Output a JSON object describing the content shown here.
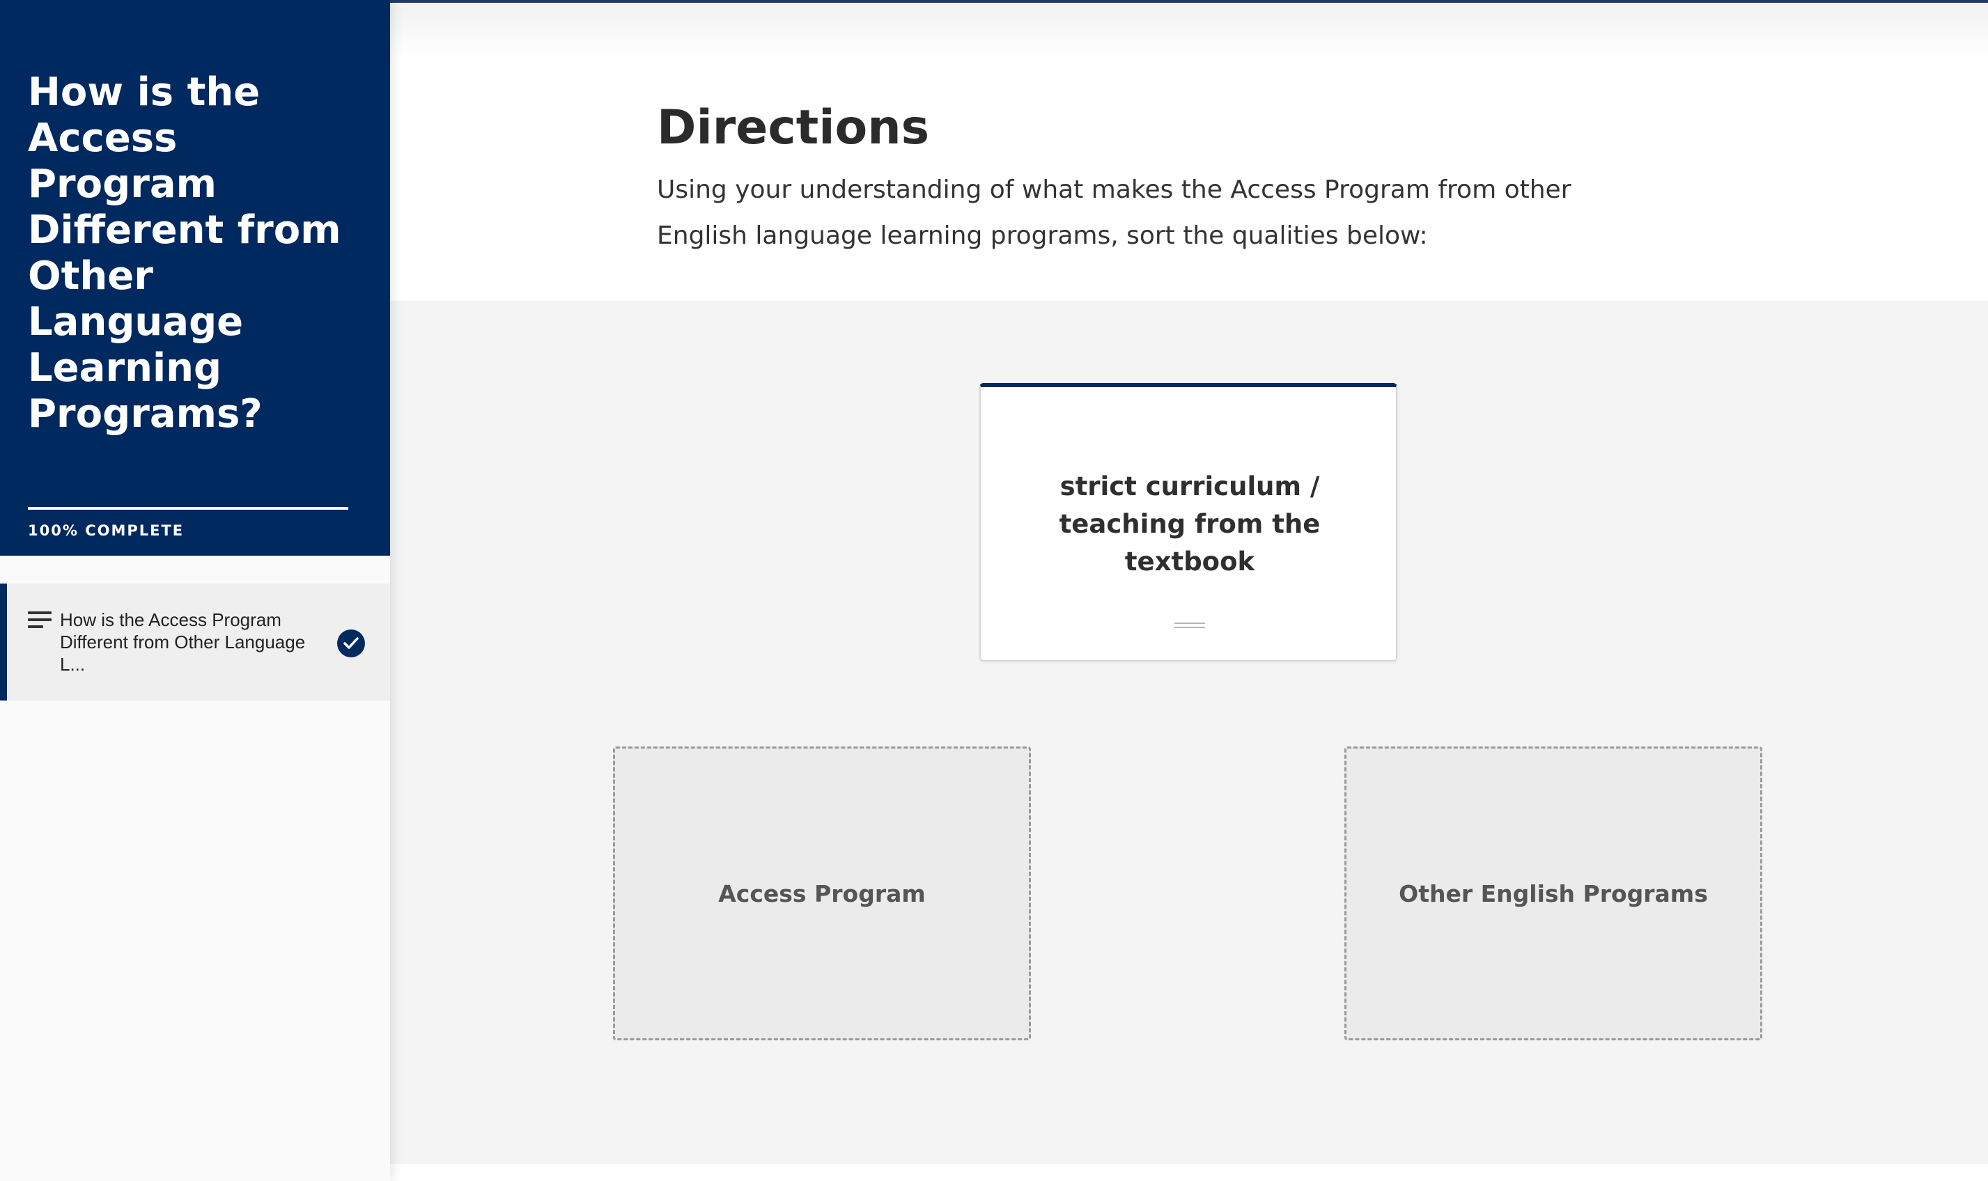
{
  "sidebar": {
    "course_title": "How is the Access Program Different from Other Language Learning Programs?",
    "progress_percent": 100,
    "progress_label": "100% COMPLETE",
    "lessons": [
      {
        "title": "How is the Access Program Different from Other Language L...",
        "icon": "lines-icon",
        "status": "complete",
        "status_icon": "check-circle-icon"
      }
    ]
  },
  "main": {
    "directions": {
      "title": "Directions",
      "text": "Using your understanding of what makes the Access Program from other English language learning programs, sort the qualities below:"
    },
    "sorting": {
      "current_card": "strict curriculum / teaching from the textbook",
      "piles": [
        "Access Program",
        "Other English Programs"
      ]
    }
  },
  "colors": {
    "brand": "#002960",
    "activity_background": "#f4f4f4",
    "dropzone_background": "#ebebeb"
  }
}
